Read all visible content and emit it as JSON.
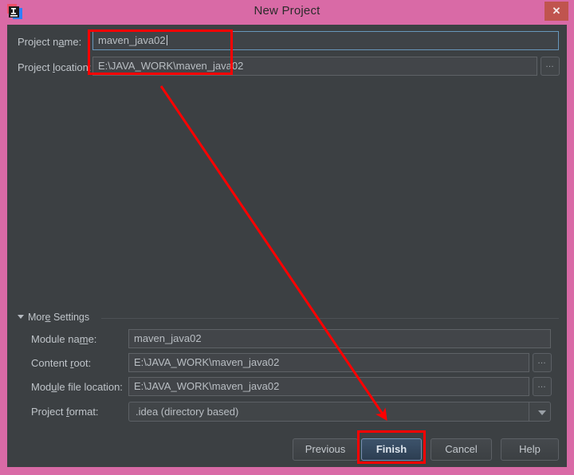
{
  "window": {
    "title": "New Project",
    "app_icon": "intellij-idea-icon",
    "close_label": "✕",
    "titlebar_color": "#d96aa6",
    "background_color": "#3c4043",
    "annotation_color": "#ff0000"
  },
  "top_form": {
    "project_name": {
      "label_pre": "Project n",
      "label_mnemonic": "a",
      "label_post": "me:",
      "value": "maven_java02",
      "focused": true
    },
    "project_location": {
      "label_pre": "Project ",
      "label_mnemonic": "l",
      "label_post": "ocation:",
      "value": "E:\\JAVA_WORK\\maven_java02",
      "browse_label": "…"
    }
  },
  "more_settings": {
    "label_pre": "Mor",
    "label_mnemonic": "e",
    "label_post": " Settings",
    "expanded": true,
    "collapse_icon": "triangle-down-icon"
  },
  "settings_form": {
    "module_name": {
      "label_pre": "Module na",
      "label_mnemonic": "m",
      "label_post": "e:",
      "value": "maven_java02"
    },
    "content_root": {
      "label_pre": "Content ",
      "label_mnemonic": "r",
      "label_post": "oot:",
      "value": "E:\\JAVA_WORK\\maven_java02",
      "browse_label": "…"
    },
    "module_file_location": {
      "label_pre": "Mod",
      "label_mnemonic": "u",
      "label_post": "le file location:",
      "value": "E:\\JAVA_WORK\\maven_java02",
      "browse_label": "…"
    },
    "project_format": {
      "label_pre": "Project ",
      "label_mnemonic": "f",
      "label_post": "ormat:",
      "value": ".idea (directory based)",
      "dropdown_icon": "chevron-down-icon"
    }
  },
  "footer": {
    "previous_label": "Previous",
    "finish_label": "Finish",
    "cancel_label": "Cancel",
    "help_label": "Help",
    "default_button": "Finish"
  },
  "annotations": {
    "highlight_fields_box": "red-rectangle-project-fields",
    "highlight_finish_box": "red-rectangle-finish-button",
    "arrow": "red-arrow-pointing-to-finish"
  }
}
